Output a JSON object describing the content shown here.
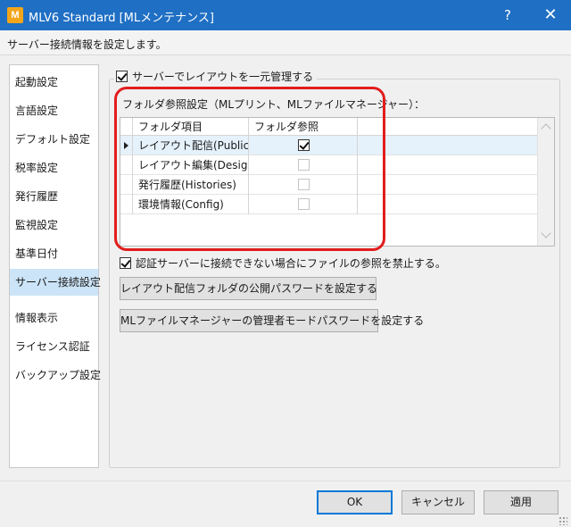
{
  "window": {
    "app_icon_text": "M",
    "title": "MLV6 Standard [MLメンテナンス]",
    "help_glyph": "?",
    "close_glyph": "✕"
  },
  "description": "サーバー接続情報を設定します。",
  "sidebar": {
    "items": [
      {
        "label": "起動設定",
        "selected": false
      },
      {
        "label": "言語設定",
        "selected": false
      },
      {
        "label": "デフォルト設定",
        "selected": false
      },
      {
        "label": "税率設定",
        "selected": false
      },
      {
        "label": "発行履歴",
        "selected": false
      },
      {
        "label": "監視設定",
        "selected": false
      },
      {
        "label": "基準日付",
        "selected": false
      },
      {
        "label": "サーバー接続設定",
        "selected": true
      },
      {
        "label": "情報表示",
        "selected": false
      },
      {
        "label": "ライセンス認証",
        "selected": false
      },
      {
        "label": "バックアップ設定",
        "selected": false
      }
    ]
  },
  "server_group": {
    "checkbox_label": "サーバーでレイアウトを一元管理する",
    "checked": true
  },
  "folder_ref": {
    "section_label": "フォルダ参照設定（MLプリント、MLファイルマネージャー）：",
    "columns": [
      "フォルダ項目",
      "フォルダ参照"
    ],
    "rows": [
      {
        "name": "レイアウト配信(Public)",
        "checked": true,
        "current": true
      },
      {
        "name": "レイアウト編集(Design)",
        "checked": false,
        "current": false
      },
      {
        "name": "発行履歴(Histories)",
        "checked": false,
        "current": false
      },
      {
        "name": "環境情報(Config)",
        "checked": false,
        "current": false
      }
    ]
  },
  "prohibit": {
    "label": "認証サーバーに接続できない場合にファイルの参照を禁止する。",
    "checked": true
  },
  "buttons": {
    "public_password": "レイアウト配信フォルダの公開パスワードを設定する",
    "manager_password": "MLファイルマネージャーの管理者モードパスワードを設定する"
  },
  "footer": {
    "ok": "OK",
    "cancel": "キャンセル",
    "apply": "適用"
  },
  "colors": {
    "titlebar": "#1f6fc4",
    "selection": "#cce4f7",
    "highlight_ring": "#e21d1d",
    "default_button_border": "#0078d7"
  }
}
